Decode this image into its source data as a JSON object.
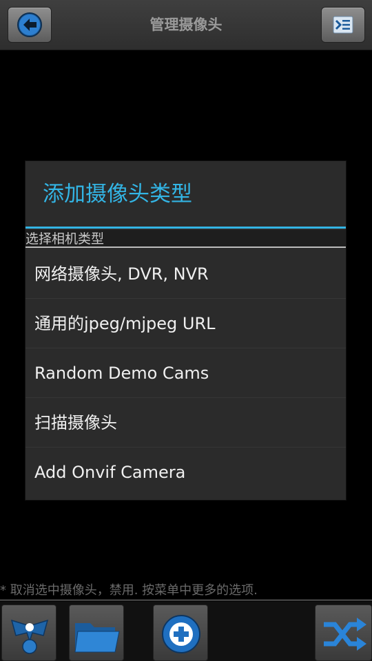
{
  "header": {
    "title": "管理摄像头",
    "back_icon": "arrow-left-icon",
    "menu_icon": "list-menu-icon"
  },
  "dialog": {
    "title": "添加摄像头类型",
    "section_label": "选择相机类型",
    "options": [
      {
        "label": "网络摄像头, DVR, NVR"
      },
      {
        "label": "通用的jpeg/mjpeg URL"
      },
      {
        "label": "Random Demo Cams"
      },
      {
        "label": "扫描摄像头"
      },
      {
        "label": "Add Onvif Camera"
      }
    ]
  },
  "footer": {
    "hint": "* 取消选中摄像头，禁用. 按菜单中更多的选项."
  },
  "toolbar": {
    "icons": [
      "camera-network-icon",
      "folder-icon",
      "add-icon",
      "shuffle-icon"
    ]
  },
  "colors": {
    "accent": "#33b5e5",
    "background": "#000000",
    "dialog": "#2b2b2b"
  }
}
